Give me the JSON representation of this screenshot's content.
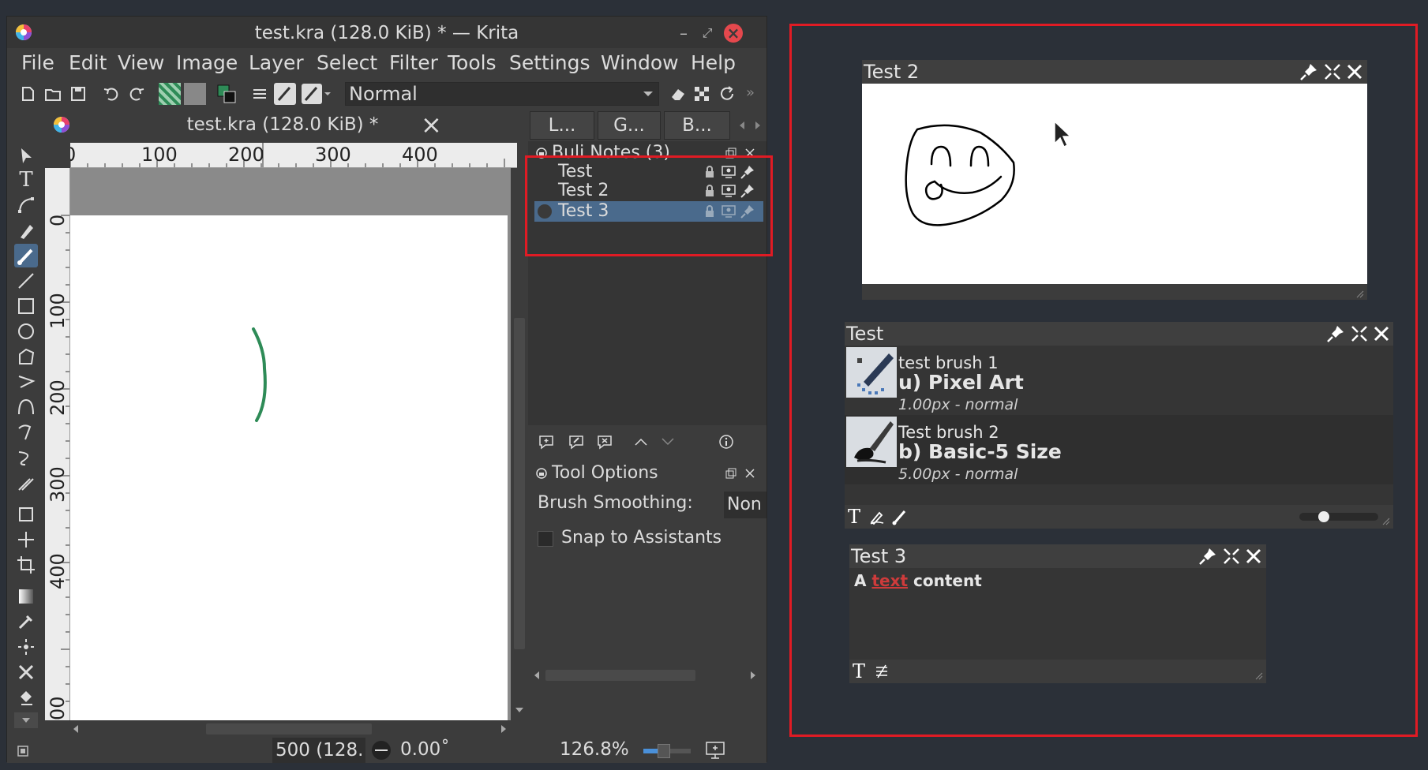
{
  "window": {
    "title": "test.kra (128.0 KiB) * — Krita",
    "minimize_glyph": "–",
    "restore_glyph": "⤢",
    "close_glyph": "×"
  },
  "menu": [
    "File",
    "Edit",
    "View",
    "Image",
    "Layer",
    "Select",
    "Filter",
    "Tools",
    "Settings",
    "Window",
    "Help"
  ],
  "toolbar": {
    "blend_mode": "Normal",
    "overflow_glyph": "»"
  },
  "document_tab": {
    "title": "test.kra (128.0 KiB) *",
    "close_glyph": "×"
  },
  "rulers": {
    "horizontal": [
      "0",
      "100",
      "200",
      "300",
      "400"
    ],
    "vertical": [
      "0",
      "100",
      "200",
      "300",
      "400",
      "00"
    ]
  },
  "dock_tabs": [
    "L...",
    "G...",
    "B..."
  ],
  "buli_notes": {
    "title": "Buli Notes (3)",
    "notes": [
      {
        "label": "Test"
      },
      {
        "label": "Test 2"
      },
      {
        "label": "Test 3",
        "selected": true
      }
    ]
  },
  "tool_options": {
    "title": "Tool Options",
    "smoothing_label": "Brush Smoothing:",
    "smoothing_value": "Non",
    "snap_label": "Snap to Assistants"
  },
  "status": {
    "size": "500 (128.",
    "rotation": "0.00˚",
    "zoom": "126.8%"
  },
  "floating_notes": {
    "test2": {
      "title": "Test 2"
    },
    "test": {
      "title": "Test",
      "brushes": [
        {
          "name": "test brush 1",
          "preset": "u) Pixel Art",
          "size": "1.00px - normal"
        },
        {
          "name": "Test brush 2",
          "preset": "b) Basic-5 Size",
          "size": "5.00px - normal"
        }
      ],
      "text_glyph": "T"
    },
    "test3": {
      "title": "Test 3",
      "text_before": "A ",
      "text_link": "text",
      "text_after": " content",
      "text_glyph": "T"
    }
  },
  "colors": {
    "highlight_red": "#e01b24",
    "selection": "#4a6a8c",
    "stroke_green": "#2e8b57"
  }
}
